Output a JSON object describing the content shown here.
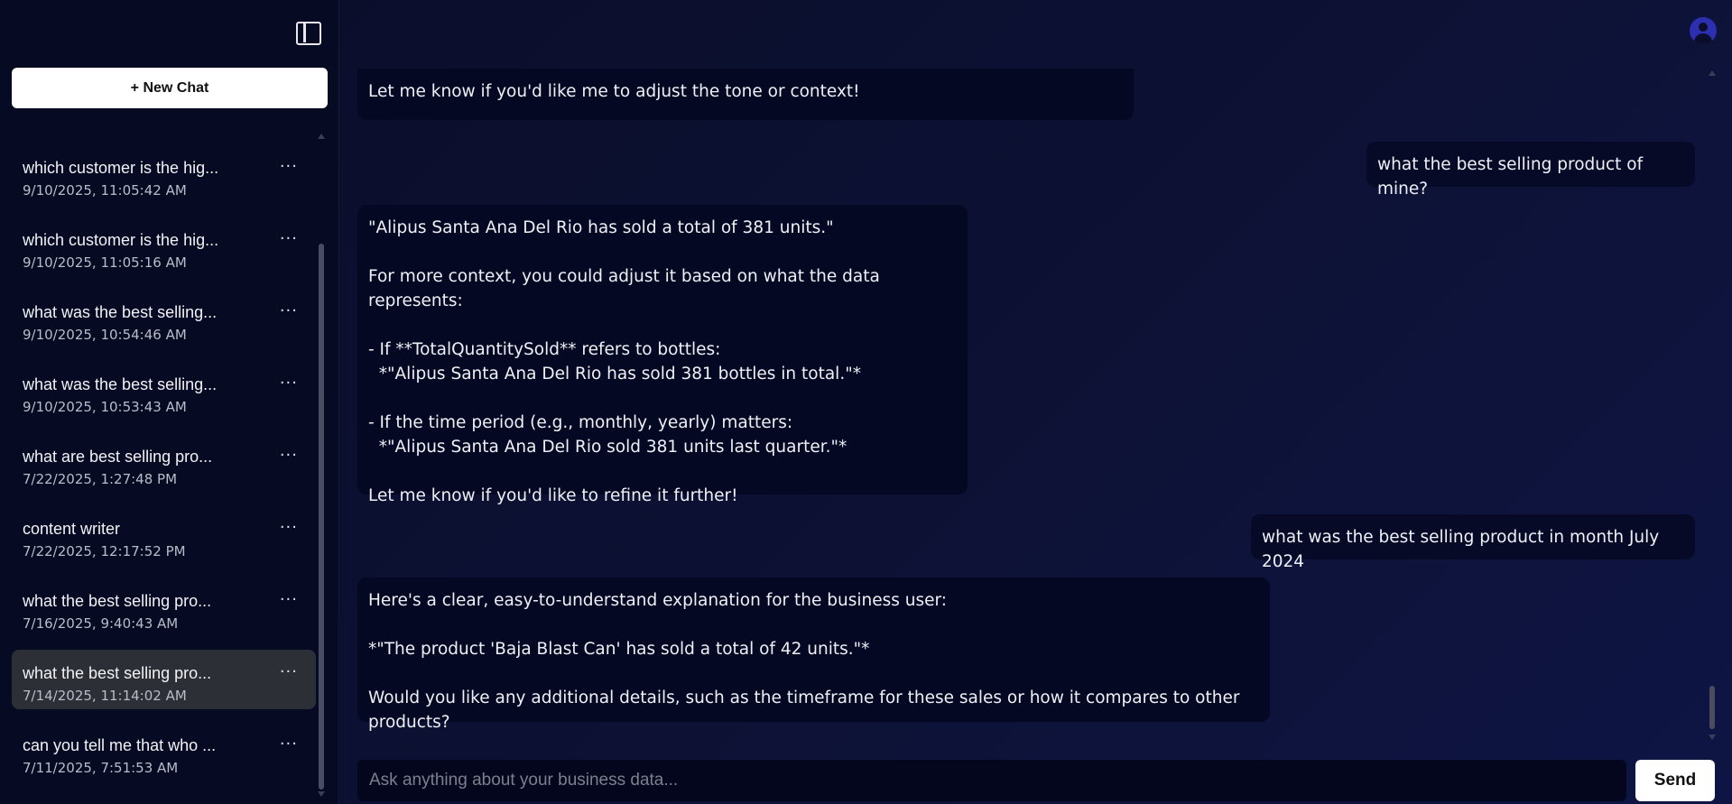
{
  "sidebar": {
    "new_chat_label": "+ New Chat",
    "chats": [
      {
        "title": "which customer is the hig...",
        "time": "9/10/2025, 11:05:42 AM"
      },
      {
        "title": "which customer is the hig...",
        "time": "9/10/2025, 11:05:16 AM"
      },
      {
        "title": "what was the best selling...",
        "time": "9/10/2025, 10:54:46 AM"
      },
      {
        "title": "what was the best selling...",
        "time": "9/10/2025, 10:53:43 AM"
      },
      {
        "title": "what are best selling pro...",
        "time": "7/22/2025, 1:27:48 PM"
      },
      {
        "title": "content writer",
        "time": "7/22/2025, 12:17:52 PM"
      },
      {
        "title": "what the best selling pro...",
        "time": "7/16/2025, 9:40:43 AM"
      },
      {
        "title": "what the best selling pro...",
        "time": "7/14/2025, 11:14:02 AM"
      },
      {
        "title": "can you tell me that who ...",
        "time": "7/11/2025, 7:51:53 AM"
      }
    ],
    "more_glyph": "···"
  },
  "messages": [
    {
      "role": "assistant",
      "text": "Let me know if you'd like me to adjust the tone or context!"
    },
    {
      "role": "user",
      "text": "what the best selling product of mine?"
    },
    {
      "role": "assistant",
      "text": "\"Alipus Santa Ana Del Rio has sold a total of 381 units.\"\n\nFor more context, you could adjust it based on what the data represents:\n\n- If **TotalQuantitySold** refers to bottles:\n  *\"Alipus Santa Ana Del Rio has sold 381 bottles in total.\"*\n\n- If the time period (e.g., monthly, yearly) matters:\n  *\"Alipus Santa Ana Del Rio sold 381 units last quarter.\"*\n\nLet me know if you'd like to refine it further!"
    },
    {
      "role": "user",
      "text": "what was the best selling product in month July 2024"
    },
    {
      "role": "assistant",
      "text": "Here's a clear, easy-to-understand explanation for the business user:\n\n*\"The product 'Baja Blast Can' has sold a total of 42 units.\"*\n\nWould you like any additional details, such as the timeframe for these sales or how it compares to other products?"
    }
  ],
  "input": {
    "placeholder": "Ask anything about your business data...",
    "value": ""
  },
  "send_label": "Send",
  "colors": {
    "background": "#0b0e2b",
    "sidebar": "#060a22",
    "bubble": "#050823",
    "active_item": "#2c2f36",
    "avatar": "#2c2fb0"
  },
  "icons": {
    "sidebar_toggle": "panel-left-icon",
    "avatar": "user-circle-icon",
    "more": "more-horizontal-icon"
  }
}
